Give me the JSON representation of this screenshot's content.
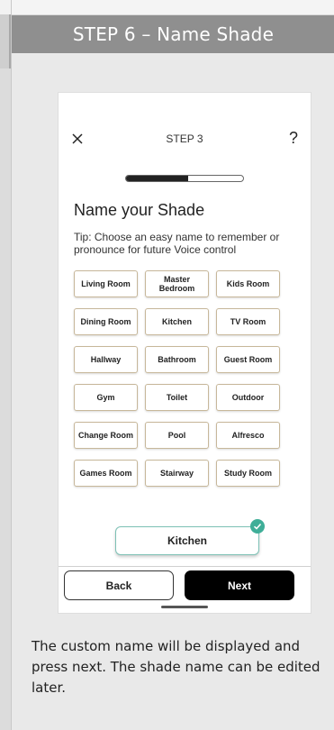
{
  "header": {
    "title": "STEP 6 – Name Shade"
  },
  "phone": {
    "step_label": "STEP 3",
    "help_symbol": "?",
    "progress": 0.53,
    "title": "Name your Shade",
    "tip": "Tip: Choose an easy name to remember or pronounce for future Voice control",
    "rooms": [
      "Living Room",
      "Master Bedroom",
      "Kids Room",
      "Dining Room",
      "Kitchen",
      "TV Room",
      "Hallway",
      "Bathroom",
      "Guest Room",
      "Gym",
      "Toilet",
      "Outdoor",
      "Change Room",
      "Pool",
      "Alfresco",
      "Games Room",
      "Stairway",
      "Study Room"
    ],
    "selected_name": "Kitchen",
    "back_label": "Back",
    "next_label": "Next",
    "colors": {
      "accent": "#3fae98",
      "chip_border": "#c7b79a",
      "primary_button": "#000000"
    },
    "icons": {
      "close": "close-icon",
      "help": "help-icon",
      "check": "check-icon"
    }
  },
  "caption": "The custom name will be displayed and press next. The shade name can be edited later."
}
